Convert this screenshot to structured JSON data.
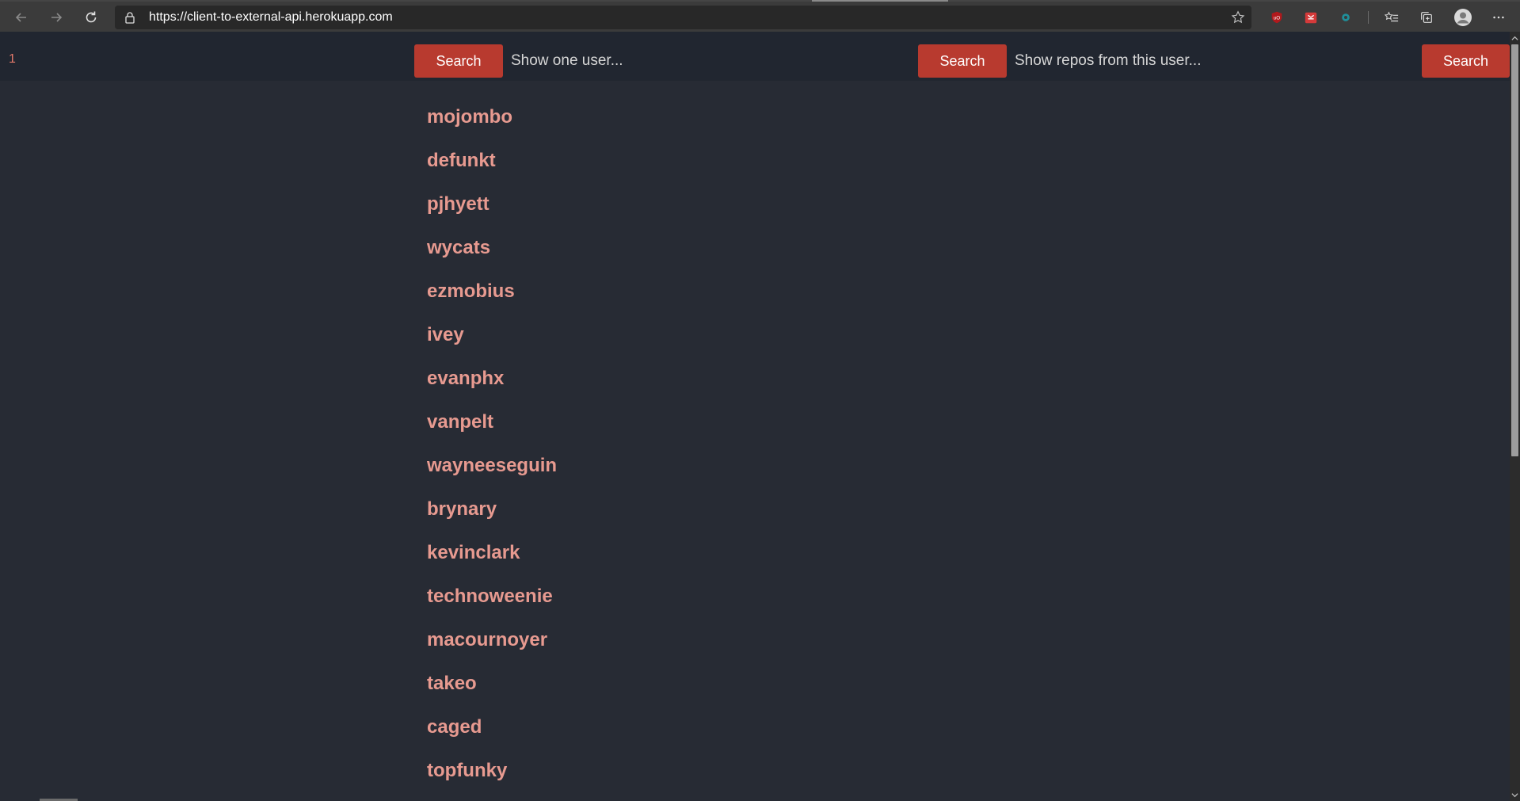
{
  "browser": {
    "url": "https://client-to-external-api.herokuapp.com",
    "icons": [
      "back-icon",
      "forward-icon",
      "refresh-icon",
      "lock-icon",
      "star-icon",
      "ublock-icon",
      "extension-icon",
      "extension-teal-icon",
      "favorites-icon",
      "collections-icon",
      "profile-icon",
      "more-icon"
    ]
  },
  "toolbar": {
    "page_number": "1",
    "search_label_1": "Search",
    "user_placeholder": "Show one user...",
    "search_label_2": "Search",
    "repos_placeholder": "Show repos from this user...",
    "search_label_3": "Search"
  },
  "users": [
    {
      "login": "mojombo"
    },
    {
      "login": "defunkt"
    },
    {
      "login": "pjhyett"
    },
    {
      "login": "wycats"
    },
    {
      "login": "ezmobius"
    },
    {
      "login": "ivey"
    },
    {
      "login": "evanphx"
    },
    {
      "login": "vanpelt"
    },
    {
      "login": "wayneeseguin"
    },
    {
      "login": "brynary"
    },
    {
      "login": "kevinclark"
    },
    {
      "login": "technoweenie"
    },
    {
      "login": "macournoyer"
    },
    {
      "login": "takeo"
    },
    {
      "login": "caged"
    },
    {
      "login": "topfunky"
    }
  ],
  "colors": {
    "page_bg": "#272b34",
    "topbar_bg": "#212630",
    "button_bg": "#b83a2f",
    "link": "#e79a90",
    "page_number": "#e57a6b"
  }
}
